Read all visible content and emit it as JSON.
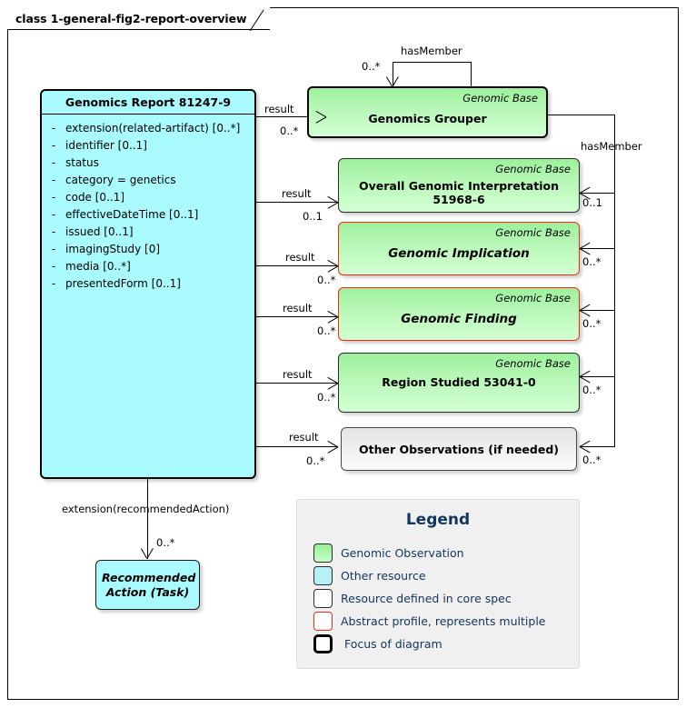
{
  "frame": {
    "tab_label": "class 1-general-fig2-report-overview"
  },
  "report": {
    "title": "Genomics Report 81247-9",
    "visibility_marker": "-",
    "attributes": [
      "extension(related-artifact) [0..*]",
      "identifier [0..1]",
      "status",
      "category = genetics",
      "code [0..1]",
      "effectiveDateTime [0..1]",
      "issued [0..1]",
      "imagingStudy [0]",
      "media [0..*]",
      "presentedForm [0..1]"
    ]
  },
  "classes": {
    "grouper": {
      "stereotype": "Genomic Base",
      "title": "Genomics Grouper"
    },
    "overall_interpretation": {
      "stereotype": "Genomic Base",
      "title": "Overall Genomic Interpretation 51968-6"
    },
    "genomic_implication": {
      "stereotype": "Genomic Base",
      "title": "Genomic Implication"
    },
    "genomic_finding": {
      "stereotype": "Genomic Base",
      "title": "Genomic Finding"
    },
    "region_studied": {
      "stereotype": "Genomic Base",
      "title": "Region Studied 53041-0"
    },
    "other_observations": {
      "title": "Other Observations (if needed)"
    },
    "recommended_action": {
      "title_line1": "Recommended",
      "title_line2": "Action (Task)"
    }
  },
  "edges": {
    "result_label": "result",
    "has_member_label": "hasMember",
    "self_has_member_label": "hasMember",
    "self_has_member_card": "0..*",
    "result_cards": {
      "grouper": "0..*",
      "overall_interpretation": "0..1",
      "genomic_implication": "0..*",
      "genomic_finding": "0..*",
      "region_studied": "0..*",
      "other_observations": "0..*"
    },
    "has_member_cards": {
      "overall_interpretation": "0..1",
      "genomic_implication": "0..*",
      "genomic_finding": "0..*",
      "region_studied": "0..*",
      "other_observations": "0..*"
    },
    "extension_label": "extension(recommendedAction)",
    "extension_card": "0..*"
  },
  "legend": {
    "title": "Legend",
    "items": [
      {
        "label": "Genomic Observation",
        "swatch": "green-fill-swatch"
      },
      {
        "label": "Other resource",
        "swatch": "cyan-fill-swatch"
      },
      {
        "label": "Resource defined in core spec",
        "swatch": "white-fill-swatch"
      },
      {
        "label": "Abstract profile, represents multiple",
        "swatch": "red-border-swatch"
      },
      {
        "label": "Focus of diagram",
        "swatch": "thick-black-border-swatch"
      }
    ]
  },
  "colors": {
    "genomic_observation": "#A7F2A7",
    "other_resource": "#AAFBFF",
    "core_spec": "#FFFFFF",
    "abstract_profile_border": "#EE2B16",
    "focus_border": "#000000",
    "legend_text": "#12355B",
    "legend_background": "#F0F0F0"
  }
}
